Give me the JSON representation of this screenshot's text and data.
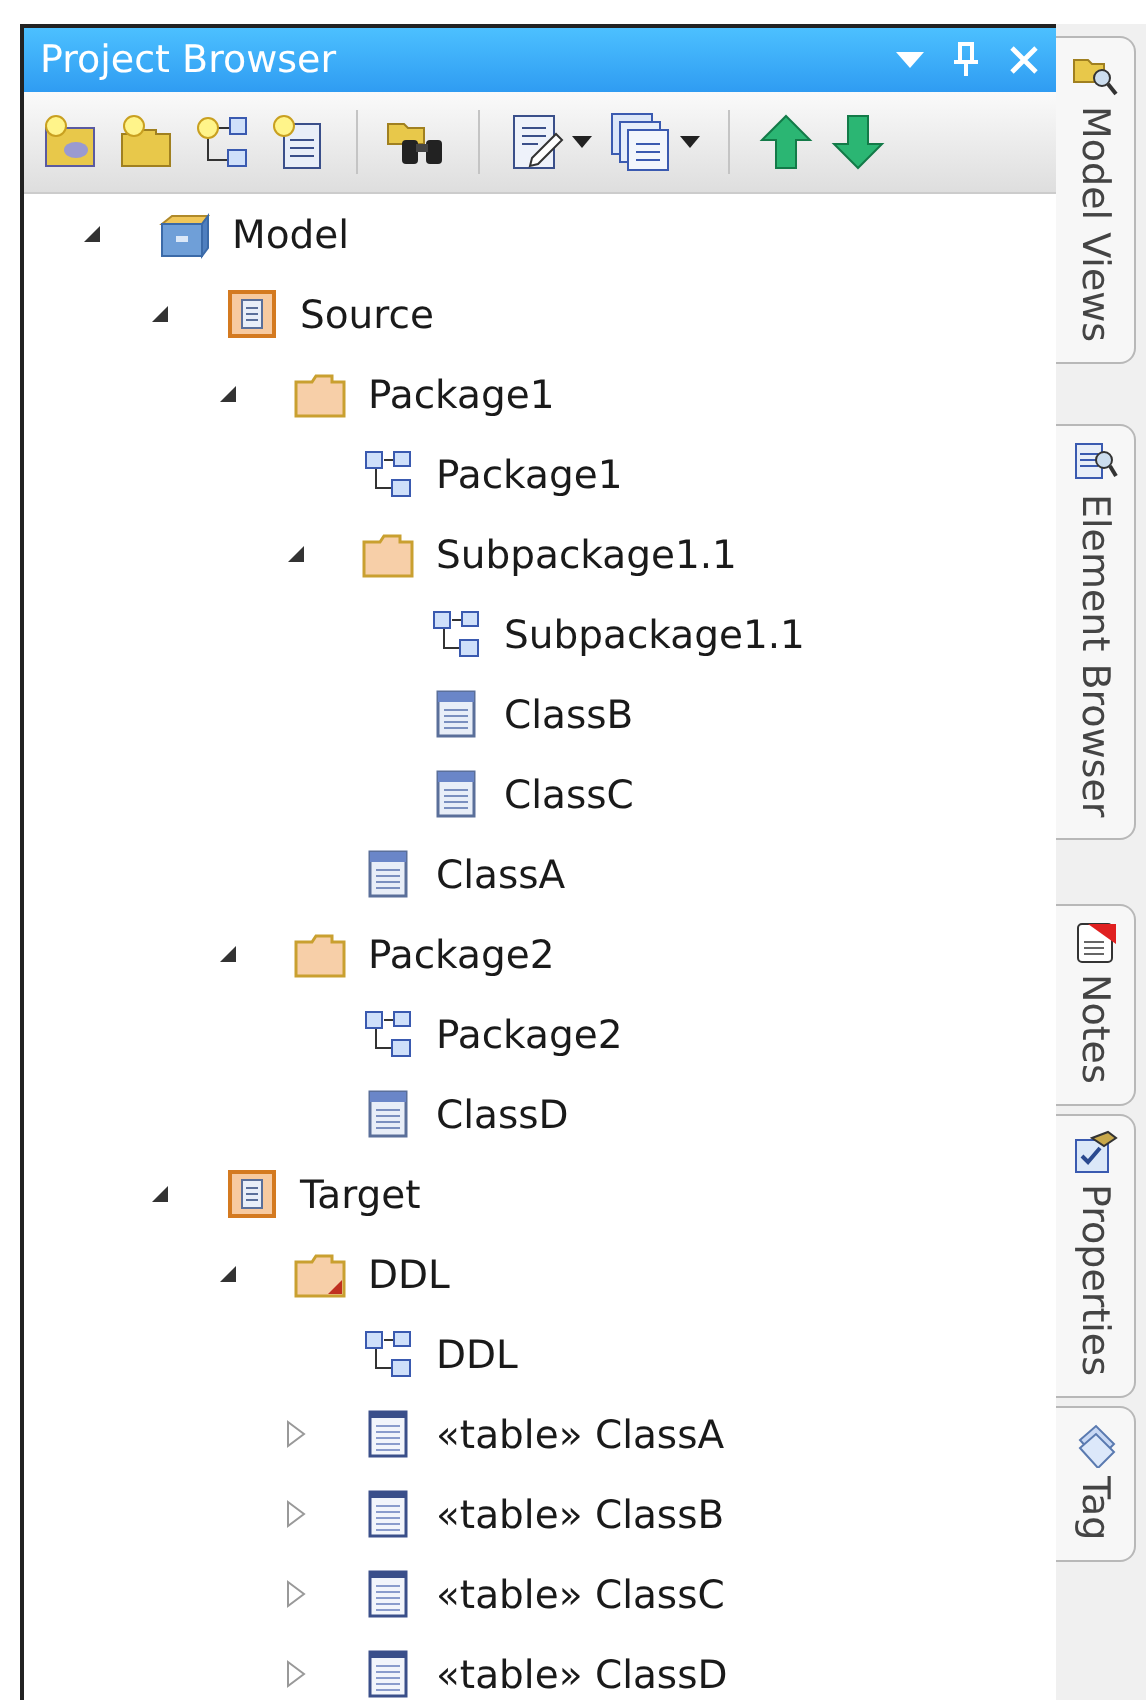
{
  "window": {
    "title": "Project Browser"
  },
  "tree": [
    {
      "label": "Model",
      "kind": "model",
      "expanded": true,
      "children": [
        {
          "label": "Source",
          "kind": "view",
          "expanded": true,
          "children": [
            {
              "label": "Package1",
              "kind": "package",
              "expanded": true,
              "children": [
                {
                  "label": "Package1",
                  "kind": "diagram"
                },
                {
                  "label": "Subpackage1.1",
                  "kind": "package",
                  "expanded": true,
                  "children": [
                    {
                      "label": "Subpackage1.1",
                      "kind": "diagram"
                    },
                    {
                      "label": "ClassB",
                      "kind": "class"
                    },
                    {
                      "label": "ClassC",
                      "kind": "class"
                    }
                  ]
                },
                {
                  "label": "ClassA",
                  "kind": "class"
                }
              ]
            },
            {
              "label": "Package2",
              "kind": "package",
              "expanded": true,
              "children": [
                {
                  "label": "Package2",
                  "kind": "diagram"
                },
                {
                  "label": "ClassD",
                  "kind": "class"
                }
              ]
            }
          ]
        },
        {
          "label": "Target",
          "kind": "view",
          "expanded": true,
          "children": [
            {
              "label": "DDL",
              "kind": "ddl-package",
              "expanded": true,
              "children": [
                {
                  "label": "DDL",
                  "kind": "diagram"
                },
                {
                  "label": "«table» ClassA",
                  "kind": "table",
                  "expanded": false
                },
                {
                  "label": "«table» ClassB",
                  "kind": "table",
                  "expanded": false
                },
                {
                  "label": "«table» ClassC",
                  "kind": "table",
                  "expanded": false
                },
                {
                  "label": "«table» ClassD",
                  "kind": "table",
                  "expanded": false
                }
              ]
            }
          ]
        }
      ]
    }
  ],
  "side_tabs": [
    {
      "label": "Model Views",
      "kind": "model-views"
    },
    {
      "label": "Element Browser",
      "kind": "element-browser"
    },
    {
      "label": "Notes",
      "kind": "notes"
    },
    {
      "label": "Properties",
      "kind": "properties"
    },
    {
      "label": "Tag",
      "kind": "tags"
    }
  ]
}
